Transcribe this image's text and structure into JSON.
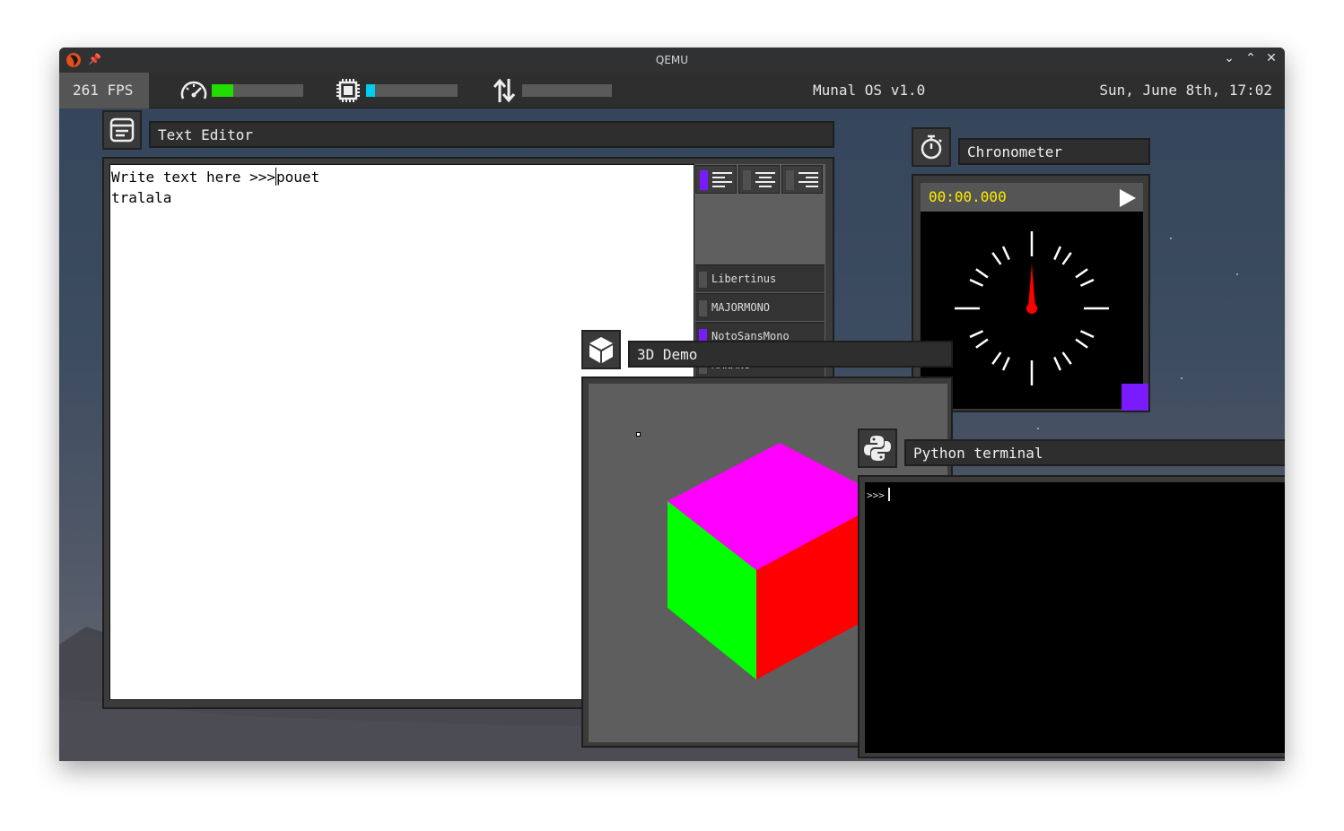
{
  "window": {
    "title": "QEMU"
  },
  "topbar": {
    "fps": "261 FPS",
    "os_name": "Munal OS v1.0",
    "datetime": "Sun, June 8th, 17:02",
    "meters": {
      "speed": {
        "icon": "speedometer-icon",
        "fill": 0.24,
        "color": "#22dd00"
      },
      "cpu": {
        "icon": "cpu-chip-icon",
        "fill": 0.1,
        "color": "#00ccee"
      },
      "network": {
        "icon": "transfer-arrows-icon",
        "fill": 0.0,
        "color": "#888888"
      }
    }
  },
  "text_editor": {
    "title": "Text Editor",
    "line1_before_cursor": "Write text here >>>",
    "line1_after_cursor": "pouet",
    "line2": "tralala",
    "fonts": [
      {
        "label": "Libertinus",
        "active": false
      },
      {
        "label": "MAJORMONO",
        "active": false
      },
      {
        "label": "NotoSansMono",
        "active": true
      },
      {
        "label": "MANANO",
        "active": false
      }
    ],
    "alignment_active": "left"
  },
  "chronometer": {
    "title": "Chronometer",
    "time": "00:00.000",
    "hand_color": "#ff0000",
    "time_color": "#ffee00"
  },
  "demo3d": {
    "title": "3D Demo",
    "colors": {
      "top": "#ff00ff",
      "left": "#00ff00",
      "right": "#ff0000"
    }
  },
  "python_terminal": {
    "title": "Python terminal",
    "prompt": ">>>"
  },
  "accent_color": "#7a1bff"
}
